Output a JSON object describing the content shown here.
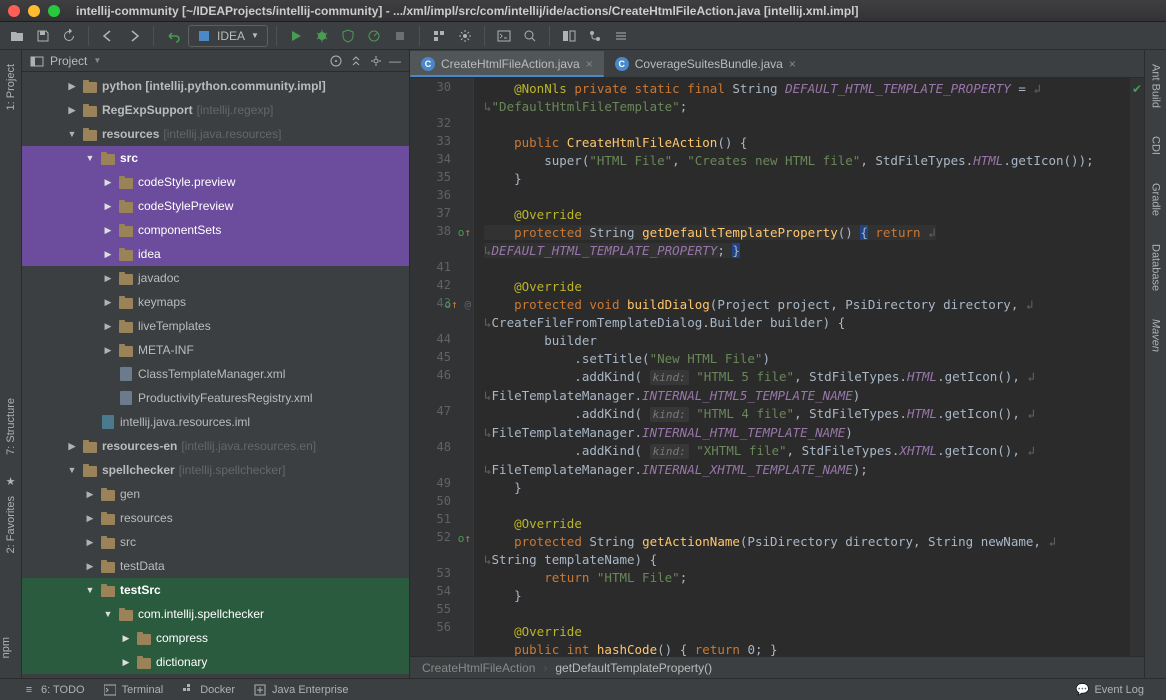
{
  "window": {
    "title": "intellij-community [~/IDEAProjects/intellij-community] - .../xml/impl/src/com/intellij/ide/actions/CreateHtmlFileAction.java [intellij.xml.impl]"
  },
  "toolbar": {
    "run_config": "IDEA"
  },
  "left_stripe": {
    "project": "1: Project",
    "structure": "7: Structure",
    "favorites": "2: Favorites",
    "npm": "npm"
  },
  "right_stripe": {
    "ant": "Ant Build",
    "cdi": "CDI",
    "gradle": "Gradle",
    "database": "Database",
    "maven": "Maven"
  },
  "project_panel": {
    "title": "Project"
  },
  "tree": [
    {
      "level": 2,
      "arrow": "▶",
      "icon": "folder",
      "label": "python [intellij.python.community.impl]",
      "bold": true,
      "hl": ""
    },
    {
      "level": 2,
      "arrow": "▶",
      "icon": "folder",
      "label": "RegExpSupport ",
      "suffix": "[intellij.regexp]",
      "bold": true,
      "hl": ""
    },
    {
      "level": 2,
      "arrow": "▼",
      "icon": "folder",
      "label": "resources ",
      "suffix": "[intellij.java.resources]",
      "bold": true,
      "hl": ""
    },
    {
      "level": 3,
      "arrow": "▼",
      "icon": "folder",
      "label": "src",
      "bold": true,
      "hl": "purple"
    },
    {
      "level": 4,
      "arrow": "▶",
      "icon": "folder",
      "label": "codeStyle.preview",
      "bold": false,
      "hl": "purple"
    },
    {
      "level": 4,
      "arrow": "▶",
      "icon": "folder",
      "label": "codeStylePreview",
      "bold": false,
      "hl": "purple"
    },
    {
      "level": 4,
      "arrow": "▶",
      "icon": "folder",
      "label": "componentSets",
      "bold": false,
      "hl": "purple"
    },
    {
      "level": 4,
      "arrow": "▶",
      "icon": "folder",
      "label": "idea",
      "bold": false,
      "hl": "purple"
    },
    {
      "level": 4,
      "arrow": "▶",
      "icon": "folder",
      "label": "javadoc",
      "bold": false,
      "hl": ""
    },
    {
      "level": 4,
      "arrow": "▶",
      "icon": "folder",
      "label": "keymaps",
      "bold": false,
      "hl": ""
    },
    {
      "level": 4,
      "arrow": "▶",
      "icon": "folder",
      "label": "liveTemplates",
      "bold": false,
      "hl": ""
    },
    {
      "level": 4,
      "arrow": "▶",
      "icon": "folder",
      "label": "META-INF",
      "bold": false,
      "hl": ""
    },
    {
      "level": 4,
      "arrow": "",
      "icon": "file",
      "label": "ClassTemplateManager.xml",
      "bold": false,
      "hl": ""
    },
    {
      "level": 4,
      "arrow": "",
      "icon": "file",
      "label": "ProductivityFeaturesRegistry.xml",
      "bold": false,
      "hl": ""
    },
    {
      "level": 3,
      "arrow": "",
      "icon": "iml",
      "label": "intellij.java.resources.iml",
      "bold": false,
      "hl": ""
    },
    {
      "level": 2,
      "arrow": "▶",
      "icon": "folder",
      "label": "resources-en ",
      "suffix": "[intellij.java.resources.en]",
      "bold": true,
      "hl": ""
    },
    {
      "level": 2,
      "arrow": "▼",
      "icon": "folder",
      "label": "spellchecker ",
      "suffix": "[intellij.spellchecker]",
      "bold": true,
      "hl": ""
    },
    {
      "level": 3,
      "arrow": "▶",
      "icon": "folder",
      "label": "gen",
      "bold": false,
      "hl": ""
    },
    {
      "level": 3,
      "arrow": "▶",
      "icon": "folder",
      "label": "resources",
      "bold": false,
      "hl": ""
    },
    {
      "level": 3,
      "arrow": "▶",
      "icon": "folder",
      "label": "src",
      "bold": false,
      "hl": ""
    },
    {
      "level": 3,
      "arrow": "▶",
      "icon": "folder",
      "label": "testData",
      "bold": false,
      "hl": ""
    },
    {
      "level": 3,
      "arrow": "▼",
      "icon": "folder",
      "label": "testSrc",
      "bold": true,
      "hl": "green"
    },
    {
      "level": 4,
      "arrow": "▼",
      "icon": "folder",
      "label": "com.intellij.spellchecker",
      "bold": false,
      "hl": "green"
    },
    {
      "level": 5,
      "arrow": "▶",
      "icon": "folder",
      "label": "compress",
      "bold": false,
      "hl": "green"
    },
    {
      "level": 5,
      "arrow": "▶",
      "icon": "folder",
      "label": "dictionary",
      "bold": false,
      "hl": "green"
    }
  ],
  "tabs": [
    {
      "label": "CreateHtmlFileAction.java",
      "active": true
    },
    {
      "label": "CoverageSuitesBundle.java",
      "active": false
    }
  ],
  "gutter": {
    "lines": [
      {
        "n": 30,
        "mark": ""
      },
      {
        "n": "",
        "mark": ""
      },
      {
        "n": 32,
        "mark": ""
      },
      {
        "n": 33,
        "mark": ""
      },
      {
        "n": 34,
        "mark": ""
      },
      {
        "n": 35,
        "mark": ""
      },
      {
        "n": 36,
        "mark": ""
      },
      {
        "n": 37,
        "mark": ""
      },
      {
        "n": 38,
        "mark": "o↑"
      },
      {
        "n": "",
        "mark": ""
      },
      {
        "n": 41,
        "mark": ""
      },
      {
        "n": 42,
        "mark": ""
      },
      {
        "n": 43,
        "mark": "o↑ @"
      },
      {
        "n": "",
        "mark": ""
      },
      {
        "n": 44,
        "mark": ""
      },
      {
        "n": 45,
        "mark": ""
      },
      {
        "n": 46,
        "mark": ""
      },
      {
        "n": "",
        "mark": ""
      },
      {
        "n": 47,
        "mark": ""
      },
      {
        "n": "",
        "mark": ""
      },
      {
        "n": 48,
        "mark": ""
      },
      {
        "n": "",
        "mark": ""
      },
      {
        "n": 49,
        "mark": ""
      },
      {
        "n": 50,
        "mark": ""
      },
      {
        "n": 51,
        "mark": ""
      },
      {
        "n": 52,
        "mark": "o↑"
      },
      {
        "n": "",
        "mark": ""
      },
      {
        "n": 53,
        "mark": ""
      },
      {
        "n": 54,
        "mark": ""
      },
      {
        "n": 55,
        "mark": ""
      },
      {
        "n": 56,
        "mark": ""
      }
    ]
  },
  "code": {
    "l30": {
      "pre": "    ",
      "ann": "@NonNls",
      "mid": " ",
      "kw1": "private static final",
      "sp": " ",
      "type": "String",
      "sp2": " ",
      "field": "DEFAULT_HTML_TEMPLATE_PROPERTY",
      "eq": " = "
    },
    "l30b": {
      "wrap": "↳",
      "str": "\"DefaultHtmlFileTemplate\"",
      "semi": ";"
    },
    "l33": {
      "pre": "    ",
      "kw": "public",
      "sp": " ",
      "method": "CreateHtmlFileAction",
      "paren": "() {"
    },
    "l34": {
      "pre": "        ",
      "call": "super(",
      "str1": "\"HTML File\"",
      "c": ", ",
      "str2": "\"Creates new HTML file\"",
      "c2": ", StdFileTypes.",
      "field": "HTML",
      "tail": ".getIcon());"
    },
    "l35": {
      "pre": "    }",
      "x": ""
    },
    "l37": {
      "pre": "    ",
      "ann": "@Override"
    },
    "l38": {
      "pre": "    ",
      "kw": "protected",
      "sp": " ",
      "type": "String",
      "sp2": " ",
      "method": "getDefaultTemplateProperty",
      "paren": "()",
      "sp3": " ",
      "br": "{",
      "sp4": " ",
      "kw2": "return"
    },
    "l38b": {
      "wrap": "↳",
      "field": "DEFAULT_HTML_TEMPLATE_PROPERTY",
      "semi": "; ",
      "br": "}"
    },
    "l41": {
      "pre": "    ",
      "ann": "@Override"
    },
    "l43": {
      "pre": "    ",
      "kw": "protected void",
      "sp": " ",
      "method": "buildDialog",
      "paren": "(Project project, PsiDirectory directory, "
    },
    "l43b": {
      "wrap": "↳",
      "text": "CreateFileFromTemplateDialog.Builder builder) {"
    },
    "l44": {
      "pre": "        builder"
    },
    "l45": {
      "pre": "            .setTitle(",
      "str": "\"New HTML File\"",
      "end": ")"
    },
    "l46": {
      "pre": "            .addKind( ",
      "param": "kind:",
      "sp": " ",
      "str": "\"HTML 5 file\"",
      "mid": ", StdFileTypes.",
      "field": "HTML",
      "tail": ".getIcon(), "
    },
    "l46b": {
      "wrap": "↳",
      "text": "FileTemplateManager.",
      "const": "INTERNAL_HTML5_TEMPLATE_NAME",
      "end": ")"
    },
    "l47": {
      "pre": "            .addKind( ",
      "param": "kind:",
      "sp": " ",
      "str": "\"HTML 4 file\"",
      "mid": ", StdFileTypes.",
      "field": "HTML",
      "tail": ".getIcon(), "
    },
    "l47b": {
      "wrap": "↳",
      "text": "FileTemplateManager.",
      "const": "INTERNAL_HTML_TEMPLATE_NAME",
      "end": ")"
    },
    "l48": {
      "pre": "            .addKind( ",
      "param": "kind:",
      "sp": " ",
      "str": "\"XHTML file\"",
      "mid": ", StdFileTypes.",
      "field": "XHTML",
      "tail": ".getIcon(), "
    },
    "l48b": {
      "wrap": "↳",
      "text": "FileTemplateManager.",
      "const": "INTERNAL_XHTML_TEMPLATE_NAME",
      "end": ");"
    },
    "l49": {
      "pre": "    }"
    },
    "l51": {
      "pre": "    ",
      "ann": "@Override"
    },
    "l52": {
      "pre": "    ",
      "kw": "protected",
      "sp": " ",
      "type": "String",
      "sp2": " ",
      "method": "getActionName",
      "paren": "(PsiDirectory directory, String newName, "
    },
    "l52b": {
      "wrap": "↳",
      "text": "String templateName) {"
    },
    "l53": {
      "pre": "        ",
      "kw": "return",
      "sp": " ",
      "str": "\"HTML File\"",
      "semi": ";"
    },
    "l54": {
      "pre": "    }"
    },
    "l56": {
      "pre": "    ",
      "ann": "@Override"
    },
    "l57": {
      "pre": "    ",
      "kw": "public int",
      "sp": " ",
      "method": "hashCode",
      "paren": "() { ",
      "kw2": "return",
      "tail": " 0; }"
    }
  },
  "breadcrumb": {
    "items": [
      "CreateHtmlFileAction",
      "getDefaultTemplateProperty()"
    ]
  },
  "statusbar": {
    "todo": "6: TODO",
    "terminal": "Terminal",
    "docker": "Docker",
    "java_enterprise": "Java Enterprise",
    "event_log": "Event Log"
  }
}
